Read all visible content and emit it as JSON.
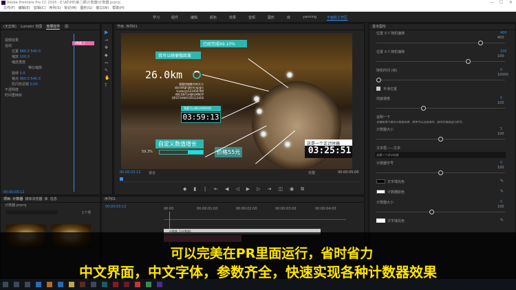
{
  "window": {
    "title": "Adobe Premiere Pro CC 2018 - E:\\AE\\PR\\第二期\\计数器\\计数器.prproj",
    "controls": [
      "—",
      "☐",
      "✕"
    ]
  },
  "menu": [
    "文件(F)",
    "编辑(E)",
    "剪辑(C)",
    "序列(S)",
    "标记(M)",
    "图形(G)",
    "窗口(W)",
    "帮助(H)"
  ],
  "workspaces": [
    "学习",
    "组件",
    "编辑",
    "颜色",
    "效果",
    "音频",
    "图形",
    "库",
    "yanning",
    "平面和工作区"
  ],
  "active_workspace": "平面和工作区",
  "left_panel": {
    "tabs": [
      "(无剪辑)",
      "Lumetri 范围",
      "效果控件",
      "源:"
    ],
    "active_tab": "效果控件",
    "rows": [
      "视频效果",
      "运动",
      "位置",
      "缩放",
      "缩放宽度",
      "等比缩放",
      "旋转",
      "锚点",
      "防闪烁滤镜",
      "不透明度",
      "时间重映射"
    ],
    "values": [
      "960.0",
      "540.0",
      "100.0",
      "0.0",
      "960.0",
      "540.0",
      "0.00"
    ],
    "clip_label": "计数器_1",
    "timecode": "00:00:03:12"
  },
  "program": {
    "tab": "节目: 序列01",
    "timecode": "00:00:03:12",
    "fit": "适合",
    "quality": "完整",
    "duration": "00:00:05:00"
  },
  "video": {
    "tag_percent": "已经完成69.10%",
    "tag_distance": "我可以随便做距离",
    "distance": "26.0km",
    "small_text": [
      "我要控制数字的大小",
      "abcdefghijklmnopqrs",
      "tuvwxyz123456789",
      "ABCDEFGHIJKLMNOP",
      "QRSTUVWXYZ0123456"
    ],
    "tag_timer": "我要可以倒计时的时间",
    "timer": "03:59:13",
    "tag_custom": "自定义数值增长",
    "progress_label": "59.3%",
    "progress": 0.593,
    "price": "价格55元",
    "tag_countdown": "这是一个正计时器",
    "countdown": "03:25:51",
    "accent": "#2fb5b0"
  },
  "right_panel": {
    "tab": "基本图形",
    "params": [
      {
        "label": "位置 X:Y 随机偏移",
        "value": "400",
        "max": "400",
        "pos": 0.82
      },
      {
        "label": "位置 X:Y 随机偏移",
        "value": "100",
        "max": "100",
        "pos": 0.72
      },
      {
        "label": "随机时间 (帧)",
        "value": "0",
        "max": "10000",
        "pos": 0.0
      },
      {
        "label": "动画速度",
        "value": "5",
        "max": "100",
        "pos": 0.36
      },
      {
        "label": "计数器大小",
        "value": "5",
        "max": "100",
        "pos": 0.5
      },
      {
        "label": "计数器字号",
        "value": "0",
        "max": "100",
        "pos": 0.5
      },
      {
        "label": "计数器大小",
        "value": "0",
        "max": "100",
        "pos": 0.43
      }
    ],
    "checkbox": "平滑位置",
    "note_title": "说明一下",
    "note": "本模板用于展示计数器效果，数字可以自由修改，修改后直接运行即可。",
    "text_field_label": "文本框——文本",
    "text_field_value": "这是一个正计时器",
    "colors": [
      {
        "label": "文字填充色",
        "hex": "#000000"
      },
      {
        "label": "计数器颜色",
        "hex": "#ffffff"
      },
      {
        "label": "文字填充色",
        "hex": "#ffffff"
      }
    ]
  },
  "project": {
    "tabs": [
      "项目: 计数器",
      "媒体浏览器",
      "库",
      "信息"
    ],
    "file": "计数器.prproj",
    "count": "1个项"
  },
  "timeline": {
    "tab": "序列01",
    "timecode": "00:00:03:12",
    "ruler": [
      "00:00",
      "00:00:01:00",
      "00:00:02:00",
      "00:00:03:00",
      "00:00:04:00"
    ],
    "clip": "计数器_1(计数器)"
  },
  "subtitle": {
    "line1": "可以完美在PR里面运行，省时省力",
    "line2": "中文界面，中文字体，参数齐全，快速实现各种计数器效果",
    "color": "#ffe400"
  }
}
